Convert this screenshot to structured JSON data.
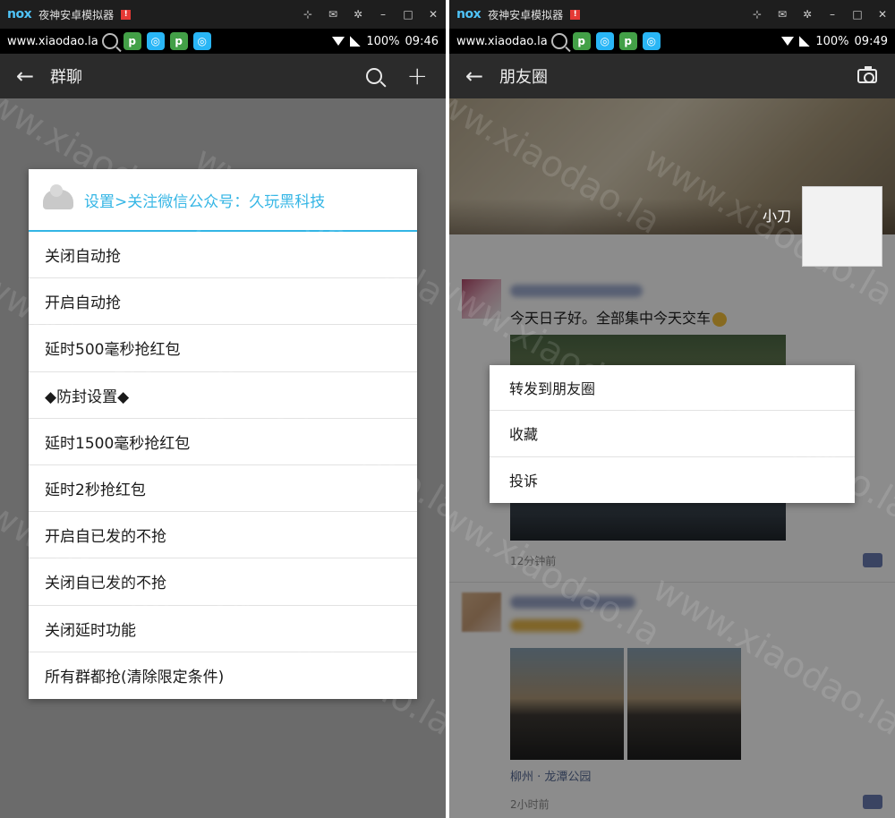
{
  "emulator": {
    "logo": "nox",
    "title": "夜神安卓模拟器",
    "badge": "!",
    "controls": [
      "pin",
      "mail",
      "settings",
      "minimize",
      "maximize",
      "close"
    ]
  },
  "left_phone": {
    "status": {
      "site": "www.xiaodao.la",
      "battery": "100%",
      "time": "09:46"
    },
    "app_bar": {
      "title": "群聊"
    },
    "menu": {
      "header": "设置>关注微信公众号：久玩黑科技",
      "items": [
        "关闭自动抢",
        "开启自动抢",
        "延时500毫秒抢红包",
        "◆防封设置◆",
        "延时1500毫秒抢红包",
        "延时2秒抢红包",
        "开启自已发的不抢",
        "关闭自已发的不抢",
        "关闭延时功能",
        "所有群都抢(清除限定条件)"
      ]
    }
  },
  "right_phone": {
    "status": {
      "site": "www.xiaodao.la",
      "battery": "100%",
      "time": "09:49"
    },
    "app_bar": {
      "title": "朋友圈"
    },
    "cover_name": "小刀",
    "post1": {
      "text": "今天日子好。全部集中今天交车",
      "time": "12分钟前"
    },
    "post2": {
      "location": "柳州 · 龙潭公园",
      "time": "2小时前"
    },
    "context_menu": {
      "items": [
        "转发到朋友圈",
        "收藏",
        "投诉"
      ]
    }
  },
  "watermark_text": "www.xiaodao.la",
  "colors": {
    "accent": "#33b5e5",
    "link": "#576b95",
    "app_bar": "#2b2b2b"
  }
}
